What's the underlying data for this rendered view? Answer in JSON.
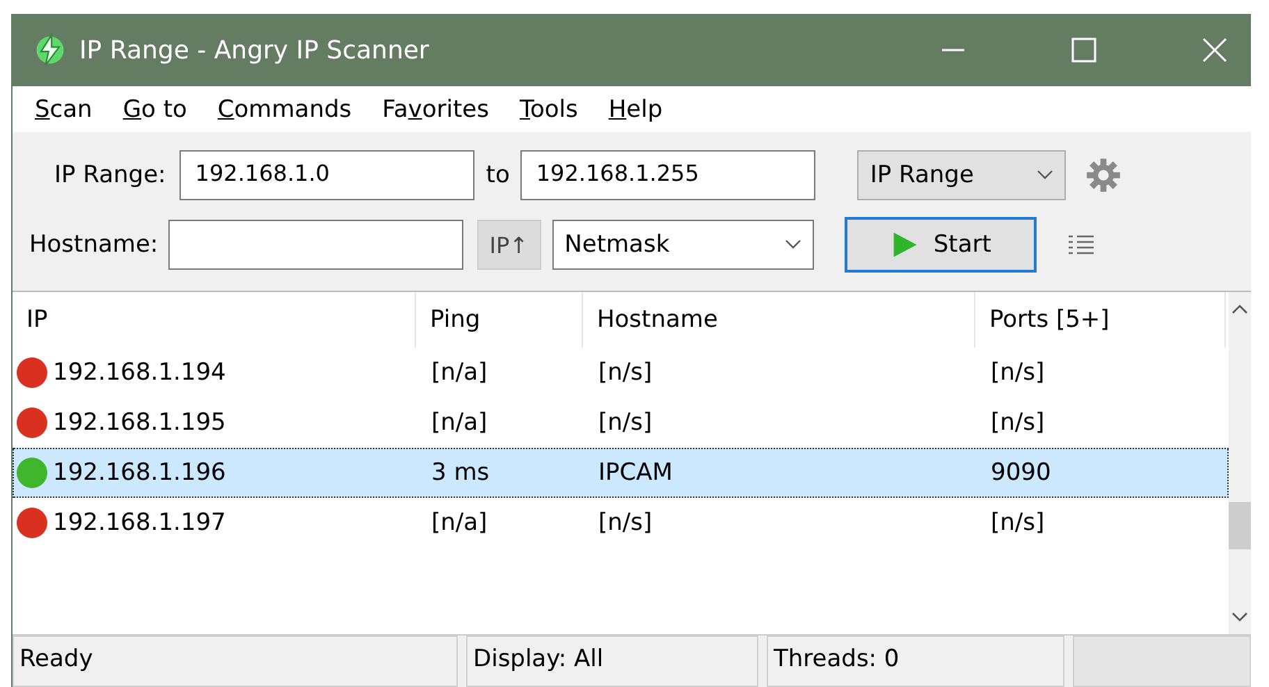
{
  "window": {
    "title": "IP Range - Angry IP Scanner"
  },
  "menu": [
    "Scan",
    "Go to",
    "Commands",
    "Favorites",
    "Tools",
    "Help"
  ],
  "toolbar": {
    "range_label": "IP Range:",
    "range_start": "192.168.1.0",
    "to_label": "to",
    "range_end": "192.168.1.255",
    "feeder": "IP Range",
    "hostname_label": "Hostname:",
    "ip_button": "IP↑",
    "netmask": "Netmask",
    "start_button": "Start"
  },
  "table": {
    "columns": [
      "IP",
      "Ping",
      "Hostname",
      "Ports [5+]"
    ],
    "rows": [
      {
        "ip": "192.168.1.194",
        "ping": "[n/a]",
        "hostname": "[n/s]",
        "ports": "[n/s]",
        "color": "#d9301f",
        "selected": false
      },
      {
        "ip": "192.168.1.195",
        "ping": "[n/a]",
        "hostname": "[n/s]",
        "ports": "[n/s]",
        "color": "#d9301f",
        "selected": false
      },
      {
        "ip": "192.168.1.196",
        "ping": "3 ms",
        "hostname": "IPCAM",
        "ports": "9090",
        "color": "#3fb62b",
        "selected": true
      },
      {
        "ip": "192.168.1.197",
        "ping": "[n/a]",
        "hostname": "[n/s]",
        "ports": "[n/s]",
        "color": "#d9301f",
        "selected": false
      }
    ]
  },
  "status_bar": [
    "Ready",
    "Display: All",
    "Threads: 0"
  ]
}
